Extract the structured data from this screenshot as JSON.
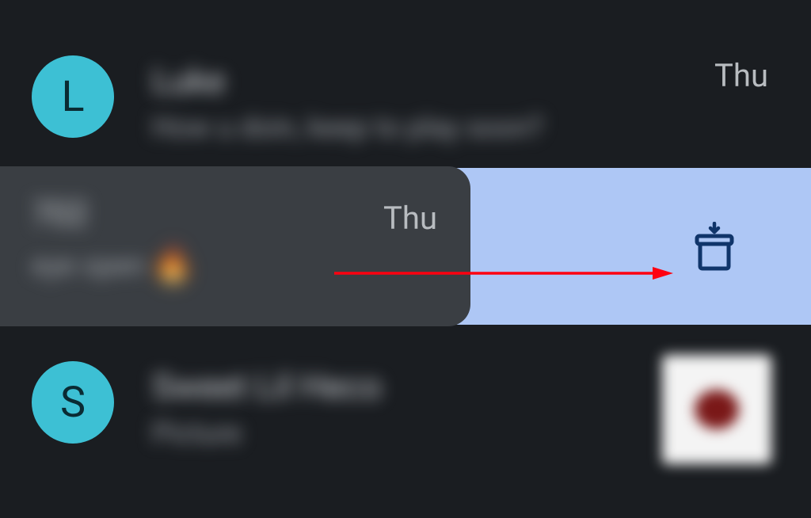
{
  "conversations": [
    {
      "avatar_letter": "L",
      "sender": "Luke",
      "preview": "How u doin, keep to play soon?",
      "timestamp": "Thu"
    },
    {
      "sender": "702",
      "preview": "eye open",
      "emoji": "🔥",
      "timestamp": "Thu"
    },
    {
      "avatar_letter": "S",
      "sender": "Sweet Lil Heco",
      "preview": "Picture"
    }
  ],
  "archive_action_label": "Archive"
}
